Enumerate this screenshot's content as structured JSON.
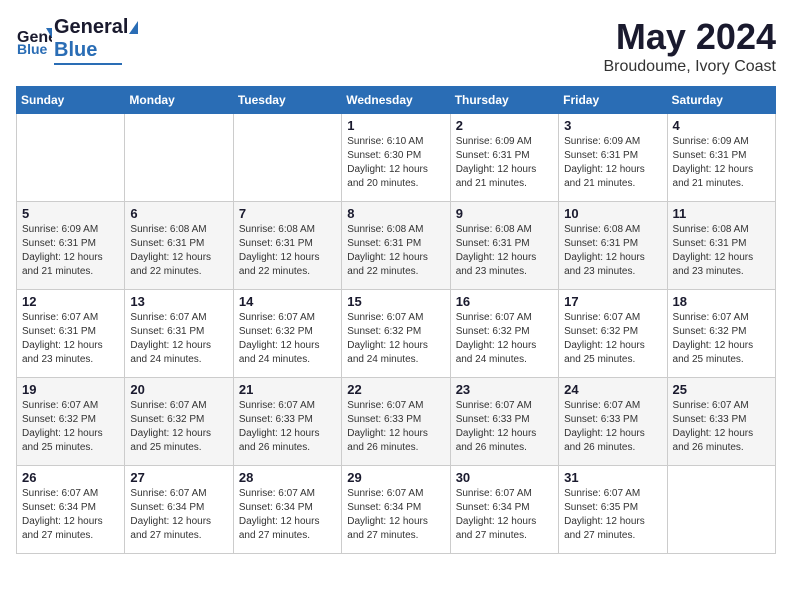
{
  "header": {
    "logo_general": "General",
    "logo_blue": "Blue",
    "title": "May 2024",
    "subtitle": "Broudoume, Ivory Coast"
  },
  "days_of_week": [
    "Sunday",
    "Monday",
    "Tuesday",
    "Wednesday",
    "Thursday",
    "Friday",
    "Saturday"
  ],
  "weeks": [
    [
      {
        "day": "",
        "sunrise": "",
        "sunset": "",
        "daylight": ""
      },
      {
        "day": "",
        "sunrise": "",
        "sunset": "",
        "daylight": ""
      },
      {
        "day": "",
        "sunrise": "",
        "sunset": "",
        "daylight": ""
      },
      {
        "day": "1",
        "sunrise": "Sunrise: 6:10 AM",
        "sunset": "Sunset: 6:30 PM",
        "daylight": "Daylight: 12 hours and 20 minutes."
      },
      {
        "day": "2",
        "sunrise": "Sunrise: 6:09 AM",
        "sunset": "Sunset: 6:31 PM",
        "daylight": "Daylight: 12 hours and 21 minutes."
      },
      {
        "day": "3",
        "sunrise": "Sunrise: 6:09 AM",
        "sunset": "Sunset: 6:31 PM",
        "daylight": "Daylight: 12 hours and 21 minutes."
      },
      {
        "day": "4",
        "sunrise": "Sunrise: 6:09 AM",
        "sunset": "Sunset: 6:31 PM",
        "daylight": "Daylight: 12 hours and 21 minutes."
      }
    ],
    [
      {
        "day": "5",
        "sunrise": "Sunrise: 6:09 AM",
        "sunset": "Sunset: 6:31 PM",
        "daylight": "Daylight: 12 hours and 21 minutes."
      },
      {
        "day": "6",
        "sunrise": "Sunrise: 6:08 AM",
        "sunset": "Sunset: 6:31 PM",
        "daylight": "Daylight: 12 hours and 22 minutes."
      },
      {
        "day": "7",
        "sunrise": "Sunrise: 6:08 AM",
        "sunset": "Sunset: 6:31 PM",
        "daylight": "Daylight: 12 hours and 22 minutes."
      },
      {
        "day": "8",
        "sunrise": "Sunrise: 6:08 AM",
        "sunset": "Sunset: 6:31 PM",
        "daylight": "Daylight: 12 hours and 22 minutes."
      },
      {
        "day": "9",
        "sunrise": "Sunrise: 6:08 AM",
        "sunset": "Sunset: 6:31 PM",
        "daylight": "Daylight: 12 hours and 23 minutes."
      },
      {
        "day": "10",
        "sunrise": "Sunrise: 6:08 AM",
        "sunset": "Sunset: 6:31 PM",
        "daylight": "Daylight: 12 hours and 23 minutes."
      },
      {
        "day": "11",
        "sunrise": "Sunrise: 6:08 AM",
        "sunset": "Sunset: 6:31 PM",
        "daylight": "Daylight: 12 hours and 23 minutes."
      }
    ],
    [
      {
        "day": "12",
        "sunrise": "Sunrise: 6:07 AM",
        "sunset": "Sunset: 6:31 PM",
        "daylight": "Daylight: 12 hours and 23 minutes."
      },
      {
        "day": "13",
        "sunrise": "Sunrise: 6:07 AM",
        "sunset": "Sunset: 6:31 PM",
        "daylight": "Daylight: 12 hours and 24 minutes."
      },
      {
        "day": "14",
        "sunrise": "Sunrise: 6:07 AM",
        "sunset": "Sunset: 6:32 PM",
        "daylight": "Daylight: 12 hours and 24 minutes."
      },
      {
        "day": "15",
        "sunrise": "Sunrise: 6:07 AM",
        "sunset": "Sunset: 6:32 PM",
        "daylight": "Daylight: 12 hours and 24 minutes."
      },
      {
        "day": "16",
        "sunrise": "Sunrise: 6:07 AM",
        "sunset": "Sunset: 6:32 PM",
        "daylight": "Daylight: 12 hours and 24 minutes."
      },
      {
        "day": "17",
        "sunrise": "Sunrise: 6:07 AM",
        "sunset": "Sunset: 6:32 PM",
        "daylight": "Daylight: 12 hours and 25 minutes."
      },
      {
        "day": "18",
        "sunrise": "Sunrise: 6:07 AM",
        "sunset": "Sunset: 6:32 PM",
        "daylight": "Daylight: 12 hours and 25 minutes."
      }
    ],
    [
      {
        "day": "19",
        "sunrise": "Sunrise: 6:07 AM",
        "sunset": "Sunset: 6:32 PM",
        "daylight": "Daylight: 12 hours and 25 minutes."
      },
      {
        "day": "20",
        "sunrise": "Sunrise: 6:07 AM",
        "sunset": "Sunset: 6:32 PM",
        "daylight": "Daylight: 12 hours and 25 minutes."
      },
      {
        "day": "21",
        "sunrise": "Sunrise: 6:07 AM",
        "sunset": "Sunset: 6:33 PM",
        "daylight": "Daylight: 12 hours and 26 minutes."
      },
      {
        "day": "22",
        "sunrise": "Sunrise: 6:07 AM",
        "sunset": "Sunset: 6:33 PM",
        "daylight": "Daylight: 12 hours and 26 minutes."
      },
      {
        "day": "23",
        "sunrise": "Sunrise: 6:07 AM",
        "sunset": "Sunset: 6:33 PM",
        "daylight": "Daylight: 12 hours and 26 minutes."
      },
      {
        "day": "24",
        "sunrise": "Sunrise: 6:07 AM",
        "sunset": "Sunset: 6:33 PM",
        "daylight": "Daylight: 12 hours and 26 minutes."
      },
      {
        "day": "25",
        "sunrise": "Sunrise: 6:07 AM",
        "sunset": "Sunset: 6:33 PM",
        "daylight": "Daylight: 12 hours and 26 minutes."
      }
    ],
    [
      {
        "day": "26",
        "sunrise": "Sunrise: 6:07 AM",
        "sunset": "Sunset: 6:34 PM",
        "daylight": "Daylight: 12 hours and 27 minutes."
      },
      {
        "day": "27",
        "sunrise": "Sunrise: 6:07 AM",
        "sunset": "Sunset: 6:34 PM",
        "daylight": "Daylight: 12 hours and 27 minutes."
      },
      {
        "day": "28",
        "sunrise": "Sunrise: 6:07 AM",
        "sunset": "Sunset: 6:34 PM",
        "daylight": "Daylight: 12 hours and 27 minutes."
      },
      {
        "day": "29",
        "sunrise": "Sunrise: 6:07 AM",
        "sunset": "Sunset: 6:34 PM",
        "daylight": "Daylight: 12 hours and 27 minutes."
      },
      {
        "day": "30",
        "sunrise": "Sunrise: 6:07 AM",
        "sunset": "Sunset: 6:34 PM",
        "daylight": "Daylight: 12 hours and 27 minutes."
      },
      {
        "day": "31",
        "sunrise": "Sunrise: 6:07 AM",
        "sunset": "Sunset: 6:35 PM",
        "daylight": "Daylight: 12 hours and 27 minutes."
      },
      {
        "day": "",
        "sunrise": "",
        "sunset": "",
        "daylight": ""
      }
    ]
  ]
}
